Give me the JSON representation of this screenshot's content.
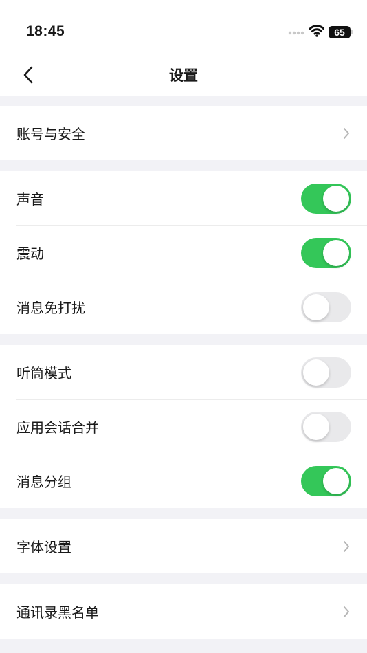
{
  "status_bar": {
    "time": "18:45",
    "battery": "65"
  },
  "nav": {
    "title": "设置"
  },
  "groups": [
    {
      "rows": [
        {
          "label": "账号与安全",
          "control": "chevron"
        }
      ]
    },
    {
      "rows": [
        {
          "label": "声音",
          "control": "toggle",
          "on": true
        },
        {
          "label": "震动",
          "control": "toggle",
          "on": true
        },
        {
          "label": "消息免打扰",
          "control": "toggle",
          "on": false
        }
      ]
    },
    {
      "rows": [
        {
          "label": "听筒模式",
          "control": "toggle",
          "on": false
        },
        {
          "label": "应用会话合并",
          "control": "toggle",
          "on": false
        },
        {
          "label": "消息分组",
          "control": "toggle",
          "on": true
        }
      ]
    },
    {
      "rows": [
        {
          "label": "字体设置",
          "control": "chevron"
        }
      ]
    },
    {
      "rows": [
        {
          "label": "通讯录黑名单",
          "control": "chevron"
        }
      ]
    }
  ],
  "colors": {
    "toggle_on": "#34c759",
    "toggle_off": "#e9e9eb",
    "page_background": "#f2f2f6",
    "chevron": "#b6b6b6"
  },
  "icons": {
    "back": "chevron-left-icon",
    "row_arrow": "chevron-right-icon",
    "wifi": "wifi-icon",
    "signal": "cellular-signal-icon",
    "battery": "battery-icon"
  }
}
